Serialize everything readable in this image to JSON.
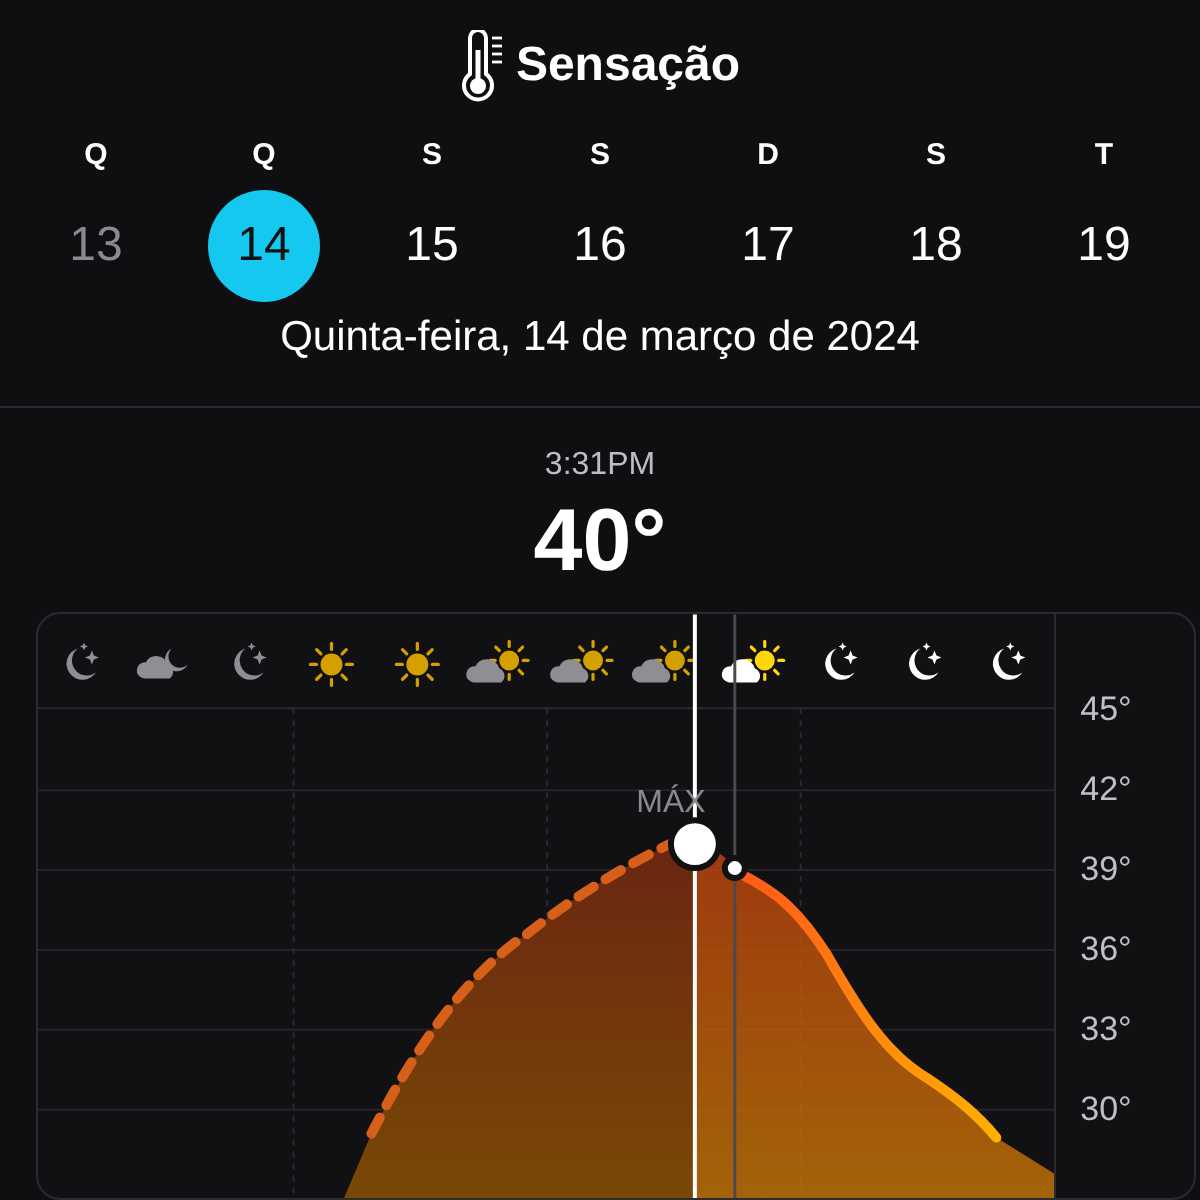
{
  "header": {
    "title": "Sensação"
  },
  "days": [
    {
      "weekday": "Q",
      "day": "13",
      "past": true,
      "selected": false
    },
    {
      "weekday": "Q",
      "day": "14",
      "past": false,
      "selected": true
    },
    {
      "weekday": "S",
      "day": "15",
      "past": false,
      "selected": false
    },
    {
      "weekday": "S",
      "day": "16",
      "past": false,
      "selected": false
    },
    {
      "weekday": "D",
      "day": "17",
      "past": false,
      "selected": false
    },
    {
      "weekday": "S",
      "day": "18",
      "past": false,
      "selected": false
    },
    {
      "weekday": "T",
      "day": "19",
      "past": false,
      "selected": false
    }
  ],
  "date": "Quinta-feira, 14 de março de 2024",
  "reading": {
    "time": "3:31PM",
    "temperature": "40°"
  },
  "hourly": [
    {
      "kind": "moon",
      "past": true
    },
    {
      "kind": "cloud-moon",
      "past": true
    },
    {
      "kind": "moon",
      "past": true
    },
    {
      "kind": "sun",
      "past": true
    },
    {
      "kind": "sun",
      "past": true
    },
    {
      "kind": "cloud-sun",
      "past": true
    },
    {
      "kind": "cloud-sun",
      "past": true
    },
    {
      "kind": "cloud-sun",
      "past": true
    },
    {
      "kind": "cloud-sun",
      "past": false
    },
    {
      "kind": "moon",
      "past": false
    },
    {
      "kind": "moon",
      "past": false
    },
    {
      "kind": "moon",
      "past": false
    }
  ],
  "chart": {
    "max_label": "MÁX",
    "axis_labels": [
      "45°",
      "42°",
      "39°",
      "36°",
      "33°",
      "30°"
    ]
  }
}
